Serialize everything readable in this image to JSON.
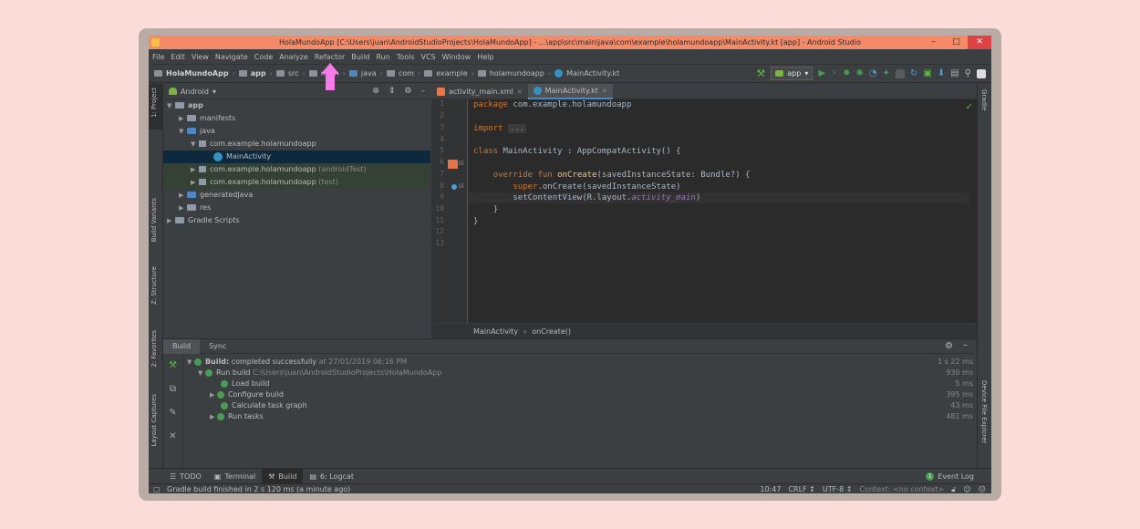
{
  "window": {
    "title": "HolaMundoApp [C:\\Users\\juan\\AndroidStudioProjects\\HolaMundoApp] - ...\\app\\src\\main\\java\\com\\example\\holamundoapp\\MainActivity.kt [app] - Android Studio",
    "minimize": "–",
    "maximize": "□",
    "close": "✕"
  },
  "menu": [
    "File",
    "Edit",
    "View",
    "Navigate",
    "Code",
    "Analyze",
    "Refactor",
    "Build",
    "Run",
    "Tools",
    "VCS",
    "Window",
    "Help"
  ],
  "breadcrumb": [
    "HolaMundoApp",
    "app",
    "src",
    "main",
    "java",
    "com",
    "example",
    "holamundoapp",
    "MainActivity.kt"
  ],
  "run_config": "app",
  "project": {
    "view_mode": "Android",
    "tree": [
      {
        "label": "app",
        "extra": ""
      },
      {
        "label": "manifests",
        "extra": ""
      },
      {
        "label": "java",
        "extra": ""
      },
      {
        "label": "com.example.holamundoapp",
        "extra": ""
      },
      {
        "label": "MainActivity",
        "extra": ""
      },
      {
        "label": "com.example.holamundoapp",
        "extra": "(androidTest)"
      },
      {
        "label": "com.example.holamundoapp",
        "extra": "(test)"
      },
      {
        "label": "generatedJava",
        "extra": ""
      },
      {
        "label": "res",
        "extra": ""
      },
      {
        "label": "Gradle Scripts",
        "extra": ""
      }
    ]
  },
  "left_tools": [
    "1: Project",
    "Build Variants",
    "Z: Structure",
    "2: Favorites",
    "Layout Captures"
  ],
  "right_tools": [
    "Gradle",
    "Device File Explorer"
  ],
  "editor": {
    "tabs": [
      "activity_main.xml",
      "MainActivity.kt"
    ],
    "line_numbers": [
      "1",
      "2",
      "3",
      "4",
      "5",
      "6",
      "7",
      "8",
      "9",
      "10",
      "11",
      "12",
      "13"
    ],
    "code": {
      "l1_kw": "package",
      "l1_rest": " com.example.holamundoapp",
      "l3_kw": "import",
      "l3_fold": "...",
      "l6_kw": "class",
      "l6_rest": " MainActivity : AppCompatActivity() {",
      "l8_kw": "override fun",
      "l8_fn": "onCreate",
      "l8_rest": "(savedInstanceState: Bundle?) {",
      "l9_kw": "super",
      "l9_rest": ".onCreate(savedInstanceState)",
      "l10_a": "setContentView(R.layout.",
      "l10_it": "activity_main",
      "l10_b": ")",
      "l11": "}",
      "l12": "}"
    },
    "crumbs": [
      "MainActivity",
      "onCreate()"
    ]
  },
  "build": {
    "tabs": [
      "Build",
      "Sync"
    ],
    "rows": [
      {
        "label": "Build:",
        "text": "completed successfully",
        "time": "at 27/01/2019 06:16 PM",
        "dur": "1 s 22 ms"
      },
      {
        "label": "Run build",
        "path": "C:\\Users\\juan\\AndroidStudioProjects\\HolaMundoApp",
        "dur": "930 ms"
      },
      {
        "label": "Load build",
        "dur": "5 ms"
      },
      {
        "label": "Configure build",
        "dur": "395 ms"
      },
      {
        "label": "Calculate task graph",
        "dur": "43 ms"
      },
      {
        "label": "Run tasks",
        "dur": "481 ms"
      }
    ]
  },
  "toolwindows": [
    "TODO",
    "Terminal",
    "Build",
    "6: Logcat"
  ],
  "event_log": "Event Log",
  "event_count": "1",
  "status": {
    "message": "Gradle build finished in 2 s 120 ms (a minute ago)",
    "position": "10:47",
    "line_sep": "CRLF ↕",
    "encoding": "UTF-8 ↕",
    "context": "Context: <no context>"
  },
  "colors": {
    "accent": "#4a88c7",
    "annotation_arrow": "#f57be8",
    "titlebar": "#f48a67",
    "background": "#fcdcd8"
  }
}
